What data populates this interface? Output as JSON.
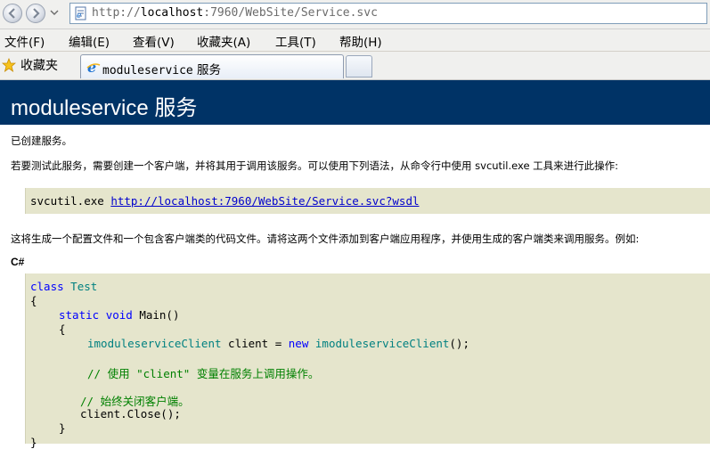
{
  "browser": {
    "url_prefix": "http://",
    "url_host": "localhost",
    "url_rest": ":7960/WebSite/Service.svc",
    "menu": [
      "文件(F)",
      "编辑(E)",
      "查看(V)",
      "收藏夹(A)",
      "工具(T)",
      "帮助(H)"
    ],
    "favorites_label": "收藏夹",
    "tab_title_mono": "moduleservice",
    "tab_title_rest": " 服务"
  },
  "page": {
    "title": "moduleservice 服务",
    "created": "已创建服务。",
    "intro": "若要测试此服务，需要创建一个客户端，并将其用于调用该服务。可以使用下列语法，从命令行中使用 svcutil.exe 工具来进行此操作:",
    "cmd_prefix": "svcutil.exe ",
    "cmd_link": "http://localhost:7960/WebSite/Service.svc?wsdl",
    "instructions": "这将生成一个配置文件和一个包含客户端类的代码文件。请将这两个文件添加到客户端应用程序，并使用生成的客户端类来调用服务。例如:",
    "lang_label": "C#"
  },
  "code": {
    "l1_kw": "class",
    "l1_ty": "Test",
    "l2": "{",
    "l3_kw1": "static",
    "l3_kw2": "void",
    "l3_rest": " Main()",
    "l4": "{",
    "l5_ty1": "imoduleserviceClient",
    "l5_mid": " client = ",
    "l5_kw": "new",
    "l5_ty2": "imoduleserviceClient",
    "l5_end": "();",
    "l6_cm": "// 使用 \"client\" 变量在服务上调用操作。",
    "l7_cm": "// 始终关闭客户端。",
    "l8": "client.Close();",
    "l9": "}",
    "l10": "}"
  }
}
